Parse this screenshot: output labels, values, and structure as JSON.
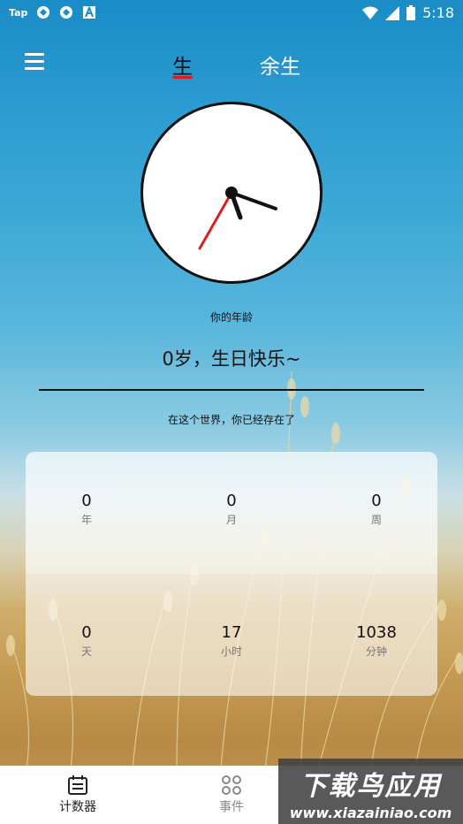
{
  "status_bar": {
    "left_label": "Tap",
    "time": "5:18",
    "icons": [
      "shield-icon",
      "shield-icon",
      "a-icon"
    ],
    "right_icons": [
      "wifi-icon",
      "signal-icon",
      "battery-icon"
    ]
  },
  "header": {
    "menu_icon": "hamburger-icon",
    "tabs": [
      {
        "label": "生",
        "active": true
      },
      {
        "label": "余生",
        "active": false
      }
    ],
    "accent": "#e21b1b"
  },
  "clock": {
    "hour_hand_color": "#111111",
    "second_hand_color": "#e21b1b"
  },
  "age": {
    "label": "你的年龄",
    "value": "0岁，生日快乐~"
  },
  "existence": {
    "label": "在这个世界，你已经存在了"
  },
  "stats": [
    {
      "num": "0",
      "unit": "年"
    },
    {
      "num": "0",
      "unit": "月"
    },
    {
      "num": "0",
      "unit": "周"
    },
    {
      "num": "0",
      "unit": "天"
    },
    {
      "num": "17",
      "unit": "小时"
    },
    {
      "num": "1038",
      "unit": "分钟"
    }
  ],
  "bottom_nav": {
    "items": [
      {
        "label": "计数器",
        "icon": "calendar-icon",
        "active": true
      },
      {
        "label": "事件",
        "icon": "grid-dots-icon",
        "active": false
      }
    ]
  },
  "watermark": {
    "title": "下载鸟应用",
    "url": "www.xiazainiao.com"
  }
}
